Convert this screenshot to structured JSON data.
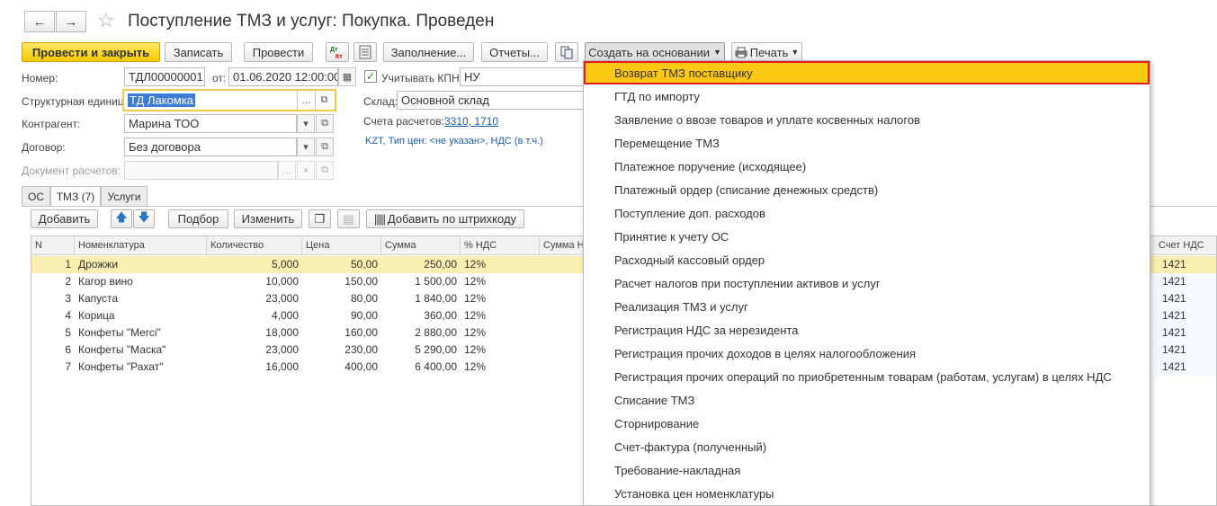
{
  "window": {
    "title": "Поступление ТМЗ и услуг: Покупка. Проведен",
    "back_icon": "←",
    "forward_icon": "→",
    "star_icon": "☆"
  },
  "toolbar": {
    "post_close": "Провести и закрыть",
    "save": "Записать",
    "post": "Провести",
    "fill": "Заполнение...",
    "reports": "Отчеты...",
    "create_based": "Создать на основании",
    "print": "Печать"
  },
  "form": {
    "number_label": "Номер:",
    "number_value": "ТДЛ00000001",
    "date_label": "от:",
    "date_value": "01.06.2020 12:00:00",
    "kpn_label": "Учитывать КПН",
    "kpn_value": "НУ",
    "unit_label": "Структурная единица:",
    "unit_value": "ТД Лакомка",
    "warehouse_label": "Склад:",
    "warehouse_value": "Основной склад",
    "counterparty_label": "Контрагент:",
    "counterparty_value": "Марина ТОО",
    "accounts_label": "Счета расчетов:",
    "accounts_value": "3310, 1710",
    "contract_label": "Договор:",
    "contract_value": "Без договора",
    "currency_info": "KZT, Тип цен: <не указан>, НДС (в т.ч.)",
    "settlement_doc_label": "Документ расчетов:",
    "settlement_doc_value": ""
  },
  "tabs": [
    "ОС",
    "ТМЗ (7)",
    "Услуги"
  ],
  "table_toolbar": {
    "add": "Добавить",
    "pick": "Подбор",
    "edit": "Изменить",
    "barcode": "Добавить по штрихкоду"
  },
  "table": {
    "headers": [
      "N",
      "Номенклатура",
      "Количество",
      "Цена",
      "Сумма",
      "% НДС",
      "Сумма Н",
      "Счет НДС"
    ],
    "rows": [
      {
        "n": "1",
        "name": "Дрожжи",
        "qty": "5,000",
        "price": "50,00",
        "sum": "250,00",
        "vat": "12%",
        "vat_acc": "1421"
      },
      {
        "n": "2",
        "name": "Кагор вино",
        "qty": "10,000",
        "price": "150,00",
        "sum": "1 500,00",
        "vat": "12%",
        "vat_acc": "1421"
      },
      {
        "n": "3",
        "name": "Капуста",
        "qty": "23,000",
        "price": "80,00",
        "sum": "1 840,00",
        "vat": "12%",
        "vat_acc": "1421"
      },
      {
        "n": "4",
        "name": "Корица",
        "qty": "4,000",
        "price": "90,00",
        "sum": "360,00",
        "vat": "12%",
        "vat_acc": "1421"
      },
      {
        "n": "5",
        "name": "Конфеты \"Merci\"",
        "qty": "18,000",
        "price": "160,00",
        "sum": "2 880,00",
        "vat": "12%",
        "vat_acc": "1421"
      },
      {
        "n": "6",
        "name": "Конфеты \"Маска\"",
        "qty": "23,000",
        "price": "230,00",
        "sum": "5 290,00",
        "vat": "12%",
        "vat_acc": "1421"
      },
      {
        "n": "7",
        "name": "Конфеты \"Рахат\"",
        "qty": "16,000",
        "price": "400,00",
        "sum": "6 400,00",
        "vat": "12%",
        "vat_acc": "1421"
      }
    ]
  },
  "menu": {
    "items": [
      "Возврат ТМЗ поставщику",
      "ГТД по импорту",
      "Заявление о ввозе товаров и уплате косвенных налогов",
      "Перемещение ТМЗ",
      "Платежное поручение (исходящее)",
      "Платежный ордер (списание денежных средств)",
      "Поступление доп. расходов",
      "Принятие к учету ОС",
      "Расходный кассовый ордер",
      "Расчет налогов при поступлении активов и услуг",
      "Реализация ТМЗ и услуг",
      "Регистрация НДС за нерезидента",
      "Регистрация прочих доходов в целях налогообложения",
      "Регистрация прочих операций по приобретенным товарам (работам, услугам) в целях НДС",
      "Списание ТМЗ",
      "Сторнирование",
      "Счет-фактура (полученный)",
      "Требование-накладная",
      "Установка цен номенклатуры"
    ]
  },
  "colors": {
    "accent_yellow": "#f4c800",
    "menu_highlight": "#fbc914",
    "highlight_border": "#e11d1d",
    "link_blue": "#1c5aa6",
    "selected_row": "#fbeeb1"
  }
}
